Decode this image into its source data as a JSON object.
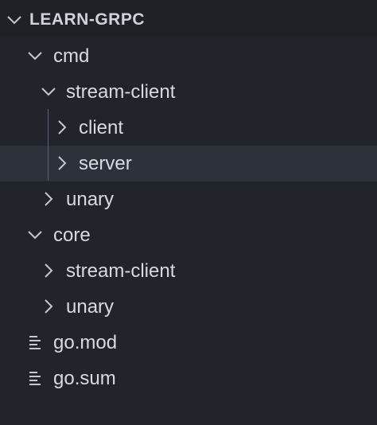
{
  "explorer": {
    "title": "LEARN-GRPC",
    "items": [
      {
        "label": "cmd",
        "type": "folder",
        "state": "expanded",
        "icon": "chevron-down-icon"
      },
      {
        "label": "stream-client",
        "type": "folder",
        "state": "expanded",
        "icon": "chevron-down-icon"
      },
      {
        "label": "client",
        "type": "folder",
        "state": "collapsed",
        "icon": "chevron-right-icon"
      },
      {
        "label": "server",
        "type": "folder",
        "state": "collapsed",
        "icon": "chevron-right-icon",
        "selected": true
      },
      {
        "label": "unary",
        "type": "folder",
        "state": "collapsed",
        "icon": "chevron-right-icon"
      },
      {
        "label": "core",
        "type": "folder",
        "state": "expanded",
        "icon": "chevron-down-icon"
      },
      {
        "label": "stream-client",
        "type": "folder",
        "state": "collapsed",
        "icon": "chevron-right-icon"
      },
      {
        "label": "unary",
        "type": "folder",
        "state": "collapsed",
        "icon": "chevron-right-icon"
      },
      {
        "label": "go.mod",
        "type": "file",
        "icon": "file-lines-icon"
      },
      {
        "label": "go.sum",
        "type": "file",
        "icon": "file-lines-icon"
      }
    ]
  },
  "colors": {
    "background": "#21252b",
    "header_background": "#1e2227",
    "selected_row": "#2c313a",
    "text": "#d7dae0",
    "icon": "#c5c8ce",
    "indent_guide": "#5c6370"
  }
}
